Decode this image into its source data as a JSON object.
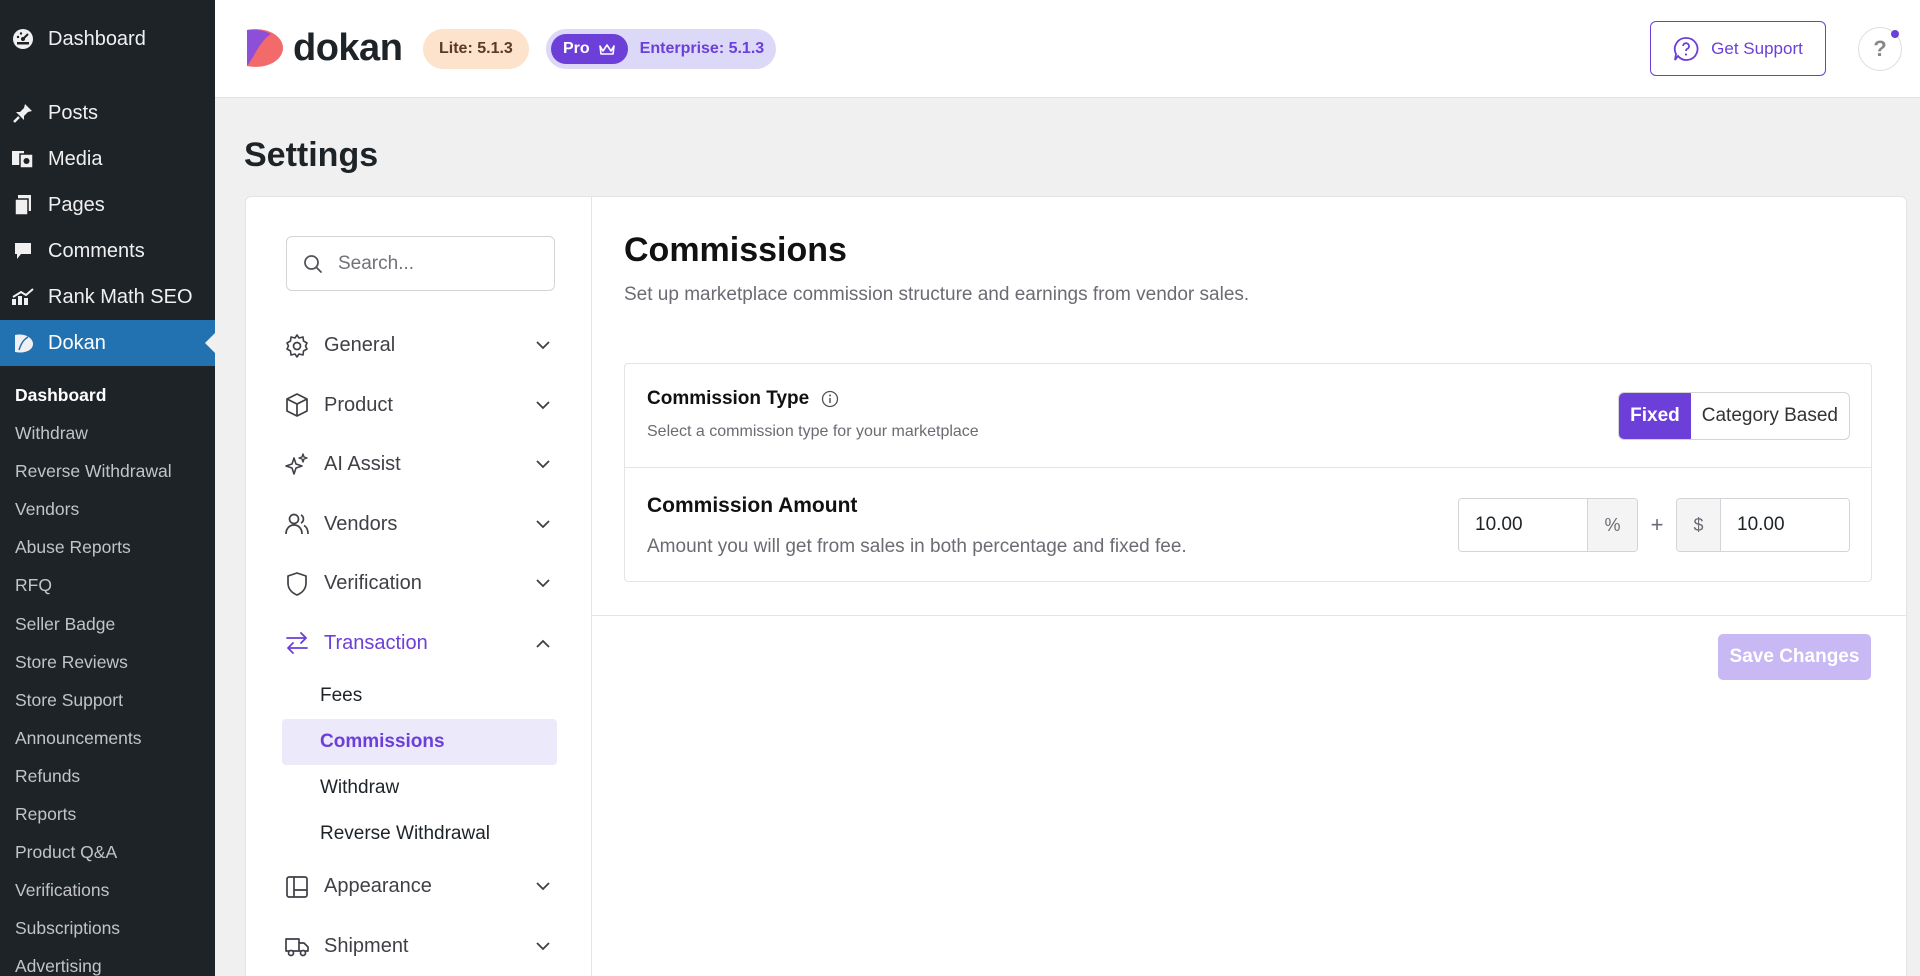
{
  "wp_menu": {
    "items": [
      {
        "label": "Dashboard",
        "icon": "dashboard-icon"
      },
      {
        "label": "Posts",
        "icon": "pin-icon"
      },
      {
        "label": "Media",
        "icon": "media-icon"
      },
      {
        "label": "Pages",
        "icon": "pages-icon"
      },
      {
        "label": "Comments",
        "icon": "comment-icon"
      },
      {
        "label": "Rank Math SEO",
        "icon": "rank-math-icon"
      },
      {
        "label": "Dokan",
        "icon": "dokan-icon"
      }
    ],
    "submenu": [
      "Dashboard",
      "Withdraw",
      "Reverse Withdrawal",
      "Vendors",
      "Abuse Reports",
      "RFQ",
      "Seller Badge",
      "Store Reviews",
      "Store Support",
      "Announcements",
      "Refunds",
      "Reports",
      "Product Q&A",
      "Verifications",
      "Subscriptions",
      "Advertising"
    ]
  },
  "header": {
    "logo_text": "dokan",
    "lite_badge": "Lite: 5.1.3",
    "pro_badge": "Pro",
    "enterprise_badge": "Enterprise: 5.1.3",
    "support_label": "Get Support",
    "help_label": "?"
  },
  "page": {
    "title": "Settings"
  },
  "settings_nav": {
    "search_placeholder": "Search...",
    "items": [
      {
        "label": "General",
        "icon": "gear-icon"
      },
      {
        "label": "Product",
        "icon": "box-icon"
      },
      {
        "label": "AI Assist",
        "icon": "sparkles-icon"
      },
      {
        "label": "Vendors",
        "icon": "users-icon"
      },
      {
        "label": "Verification",
        "icon": "shield-icon"
      },
      {
        "label": "Transaction",
        "icon": "arrows-exchange-icon"
      },
      {
        "label": "Appearance",
        "icon": "layout-icon"
      },
      {
        "label": "Shipment",
        "icon": "truck-icon"
      }
    ],
    "transaction_sub": [
      "Fees",
      "Commissions",
      "Withdraw",
      "Reverse Withdrawal"
    ]
  },
  "commissions": {
    "title": "Commissions",
    "description": "Set up marketplace commission structure and earnings from vendor sales.",
    "type_label": "Commission Type",
    "type_help": "Select a commission type for your marketplace",
    "type_options": [
      "Fixed",
      "Category Based"
    ],
    "amount_label": "Commission Amount",
    "amount_help": "Amount you will get from sales in both percentage and fixed fee.",
    "percent_value": "10.00",
    "percent_symbol": "%",
    "plus": "+",
    "currency_symbol": "$",
    "fixed_value": "10.00",
    "save_label": "Save Changes"
  },
  "colors": {
    "accent": "#6b3fd8",
    "wp_active": "#2271b1",
    "wp_sidebar": "#1d2327"
  }
}
